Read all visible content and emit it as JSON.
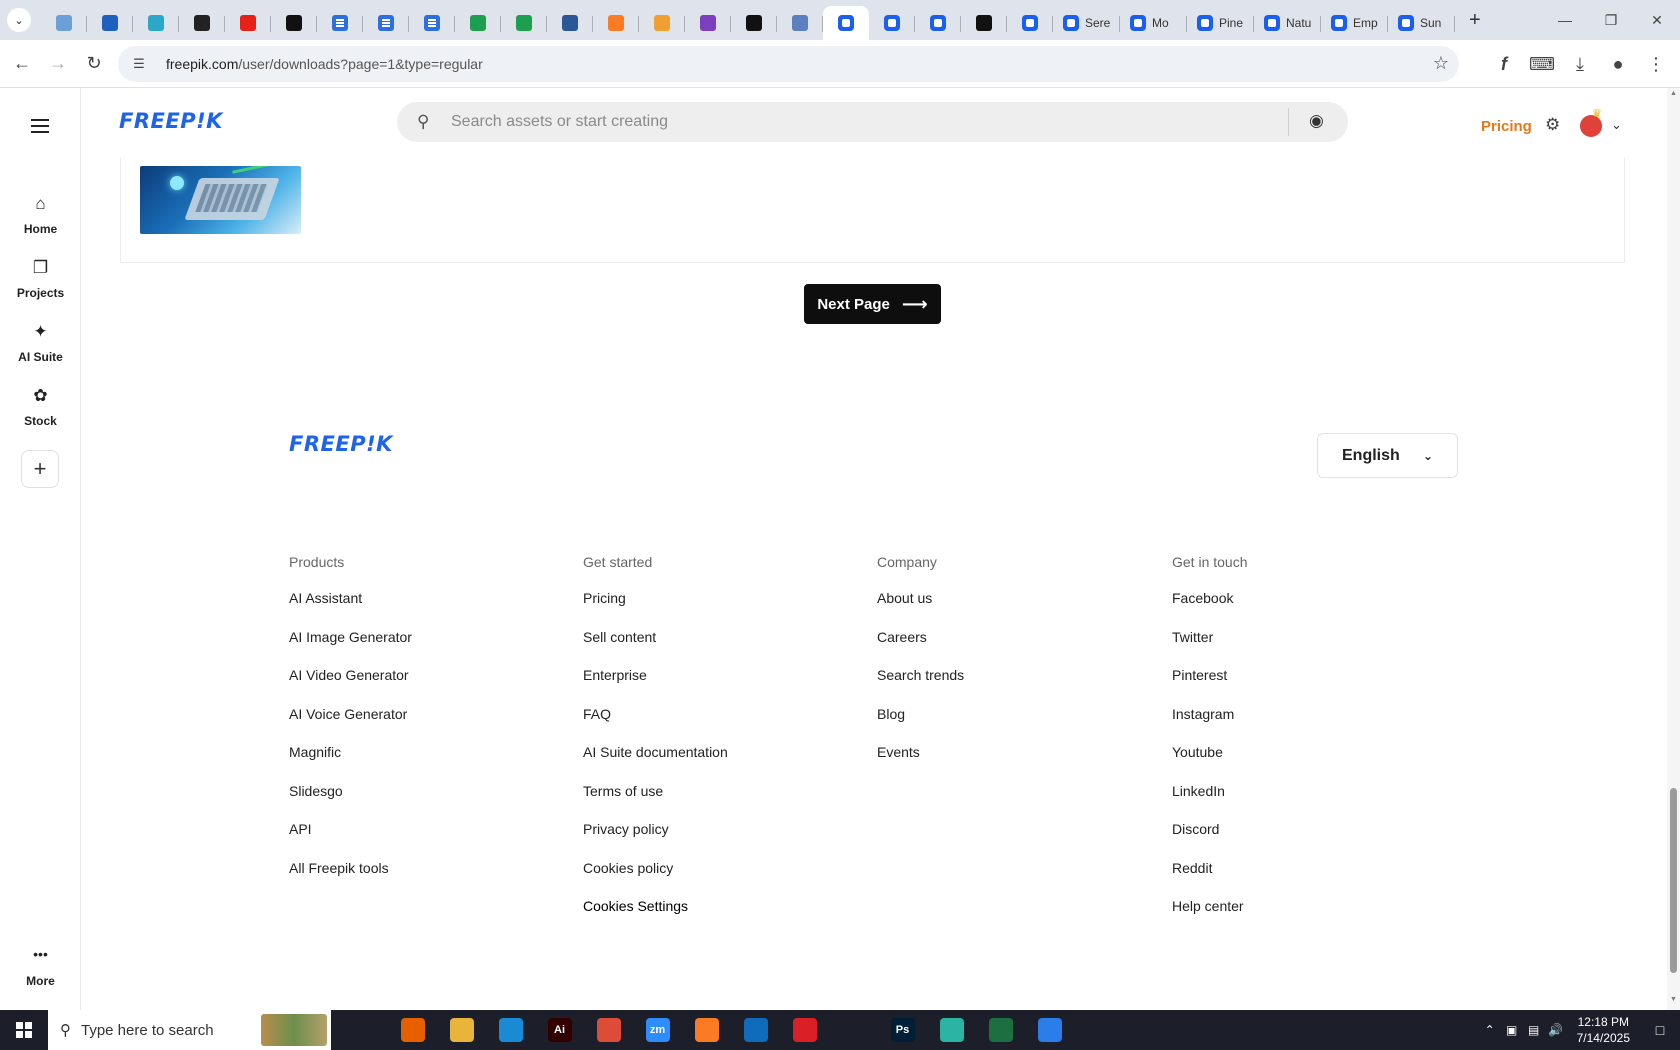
{
  "browser": {
    "tabs": [
      {
        "icon": "circle-icon",
        "label": "",
        "kind": "small"
      },
      {
        "icon": "shield-icon",
        "label": "",
        "kind": "small"
      },
      {
        "icon": "hex-icon",
        "label": "",
        "kind": "small"
      },
      {
        "icon": "openai-icon",
        "label": "",
        "kind": "small"
      },
      {
        "icon": "youtube-icon",
        "label": "",
        "kind": "small"
      },
      {
        "icon": "bolt-icon",
        "label": "",
        "kind": "small"
      },
      {
        "icon": "docs-icon",
        "label": "",
        "kind": "small"
      },
      {
        "icon": "docs-icon",
        "label": "",
        "kind": "small"
      },
      {
        "icon": "docs-icon",
        "label": "",
        "kind": "small"
      },
      {
        "icon": "sheets-icon",
        "label": "",
        "kind": "small"
      },
      {
        "icon": "sheets-icon",
        "label": "",
        "kind": "small"
      },
      {
        "icon": "word-icon",
        "label": "",
        "kind": "small"
      },
      {
        "icon": "xampp-icon",
        "label": "",
        "kind": "small"
      },
      {
        "icon": "crown-icon",
        "label": "",
        "kind": "small"
      },
      {
        "icon": "braces-icon",
        "label": "",
        "kind": "small"
      },
      {
        "icon": "anthropic-icon",
        "label": "",
        "kind": "small"
      },
      {
        "icon": "grid-icon",
        "label": "",
        "kind": "small"
      },
      {
        "icon": "freepik-icon",
        "label": "",
        "kind": "active"
      },
      {
        "icon": "freepik-icon",
        "label": "",
        "kind": "small"
      },
      {
        "icon": "freepik-icon",
        "label": "",
        "kind": "small"
      },
      {
        "icon": "medium-icon",
        "label": "",
        "kind": "small"
      },
      {
        "icon": "freepik-icon",
        "label": "",
        "kind": "small"
      },
      {
        "icon": "freepik-icon",
        "label": "Sere",
        "kind": "wide"
      },
      {
        "icon": "freepik-icon",
        "label": "Mo",
        "kind": "wide"
      },
      {
        "icon": "freepik-icon",
        "label": "Pine",
        "kind": "wide"
      },
      {
        "icon": "freepik-icon",
        "label": "Natu",
        "kind": "wide"
      },
      {
        "icon": "freepik-icon",
        "label": "Emp",
        "kind": "wide"
      },
      {
        "icon": "freepik-icon",
        "label": "Sun",
        "kind": "wide"
      }
    ],
    "url_host": "freepik.com",
    "url_path": "/user/downloads?page=1&type=regular"
  },
  "sidebar": {
    "items": [
      {
        "label": "Home",
        "icon": "home-icon"
      },
      {
        "label": "Projects",
        "icon": "projects-icon"
      },
      {
        "label": "AI Suite",
        "icon": "sparkle-icon"
      },
      {
        "label": "Stock",
        "icon": "stock-icon"
      }
    ],
    "more_label": "More"
  },
  "header": {
    "logo": "FREEP!K",
    "search_placeholder": "Search assets or start creating",
    "pricing": "Pricing"
  },
  "main": {
    "next_page": "Next Page"
  },
  "footer": {
    "logo": "FREEP!K",
    "language": "English",
    "columns": [
      {
        "heading": "Products",
        "links": [
          "AI Assistant",
          "AI Image Generator",
          "AI Video Generator",
          "AI Voice Generator",
          "Magnific",
          "Slidesgo",
          "API",
          "All Freepik tools"
        ]
      },
      {
        "heading": "Get started",
        "links": [
          "Pricing",
          "Sell content",
          "Enterprise",
          "FAQ",
          "AI Suite documentation",
          "Terms of use",
          "Privacy policy",
          "Cookies policy",
          "Cookies Settings"
        ]
      },
      {
        "heading": "Company",
        "links": [
          "About us",
          "Careers",
          "Search trends",
          "Blog",
          "Events"
        ]
      },
      {
        "heading": "Get in touch",
        "links": [
          "Facebook",
          "Twitter",
          "Pinterest",
          "Instagram",
          "Youtube",
          "LinkedIn",
          "Discord",
          "Reddit",
          "Help center"
        ]
      }
    ]
  },
  "taskbar": {
    "search_placeholder": "Type here to search",
    "time": "12:18 PM",
    "date": "7/14/2025",
    "apps": [
      {
        "icon": "task-view-icon",
        "text": "",
        "color": "#1c1f2a"
      },
      {
        "icon": "firefox-icon",
        "text": "",
        "color": "#e66000"
      },
      {
        "icon": "file-explorer-icon",
        "text": "",
        "color": "#e8b53a"
      },
      {
        "icon": "vscode-icon",
        "text": "",
        "color": "#1a8ad4"
      },
      {
        "icon": "illustrator-icon",
        "text": "Ai",
        "color": "#330000"
      },
      {
        "icon": "chrome-icon",
        "text": "",
        "color": "#dd4b39"
      },
      {
        "icon": "zoom-icon",
        "text": "zm",
        "color": "#2d8cff"
      },
      {
        "icon": "xampp-icon",
        "text": "",
        "color": "#fb7a24"
      },
      {
        "icon": "outlook-icon",
        "text": "",
        "color": "#0f6cbd"
      },
      {
        "icon": "creative-cloud-icon",
        "text": "",
        "color": "#da1f26"
      },
      {
        "icon": "pen-tool-icon",
        "text": "",
        "color": "#1c1f2a"
      },
      {
        "icon": "photoshop-icon",
        "text": "Ps",
        "color": "#001e36"
      },
      {
        "icon": "app-icon",
        "text": "",
        "color": "#2bb3a3"
      },
      {
        "icon": "excel-icon",
        "text": "",
        "color": "#1d6f42"
      },
      {
        "icon": "paint-icon",
        "text": "",
        "color": "#2b7de9"
      }
    ]
  },
  "colors": {
    "brand_blue": "#1f63e8",
    "pricing_orange": "#e37a1c",
    "button_black": "#0e0e0e"
  }
}
